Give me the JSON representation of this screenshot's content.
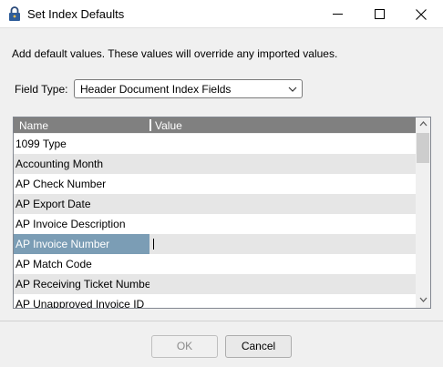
{
  "window": {
    "title": "Set Index Defaults",
    "icon": "lock-icon"
  },
  "description": "Add default values. These values will override any imported values.",
  "field_type": {
    "label": "Field Type:",
    "selected": "Header Document Index Fields"
  },
  "grid": {
    "columns": [
      "Name",
      "Value"
    ],
    "rows": [
      {
        "name": "1099 Type",
        "value": ""
      },
      {
        "name": "Accounting Month",
        "value": ""
      },
      {
        "name": "AP Check Number",
        "value": ""
      },
      {
        "name": "AP Export Date",
        "value": ""
      },
      {
        "name": "AP Invoice Description",
        "value": ""
      },
      {
        "name": "AP Invoice Number",
        "value": "",
        "selected": true
      },
      {
        "name": "AP Match Code",
        "value": ""
      },
      {
        "name": "AP Receiving Ticket Number",
        "value": ""
      },
      {
        "name": "AP Unapproved Invoice ID",
        "value": ""
      }
    ]
  },
  "buttons": {
    "ok": "OK",
    "cancel": "Cancel"
  },
  "colors": {
    "header_bg": "#808080",
    "selected_cell": "#7b9db5",
    "alt_row": "#e6e6e6"
  }
}
